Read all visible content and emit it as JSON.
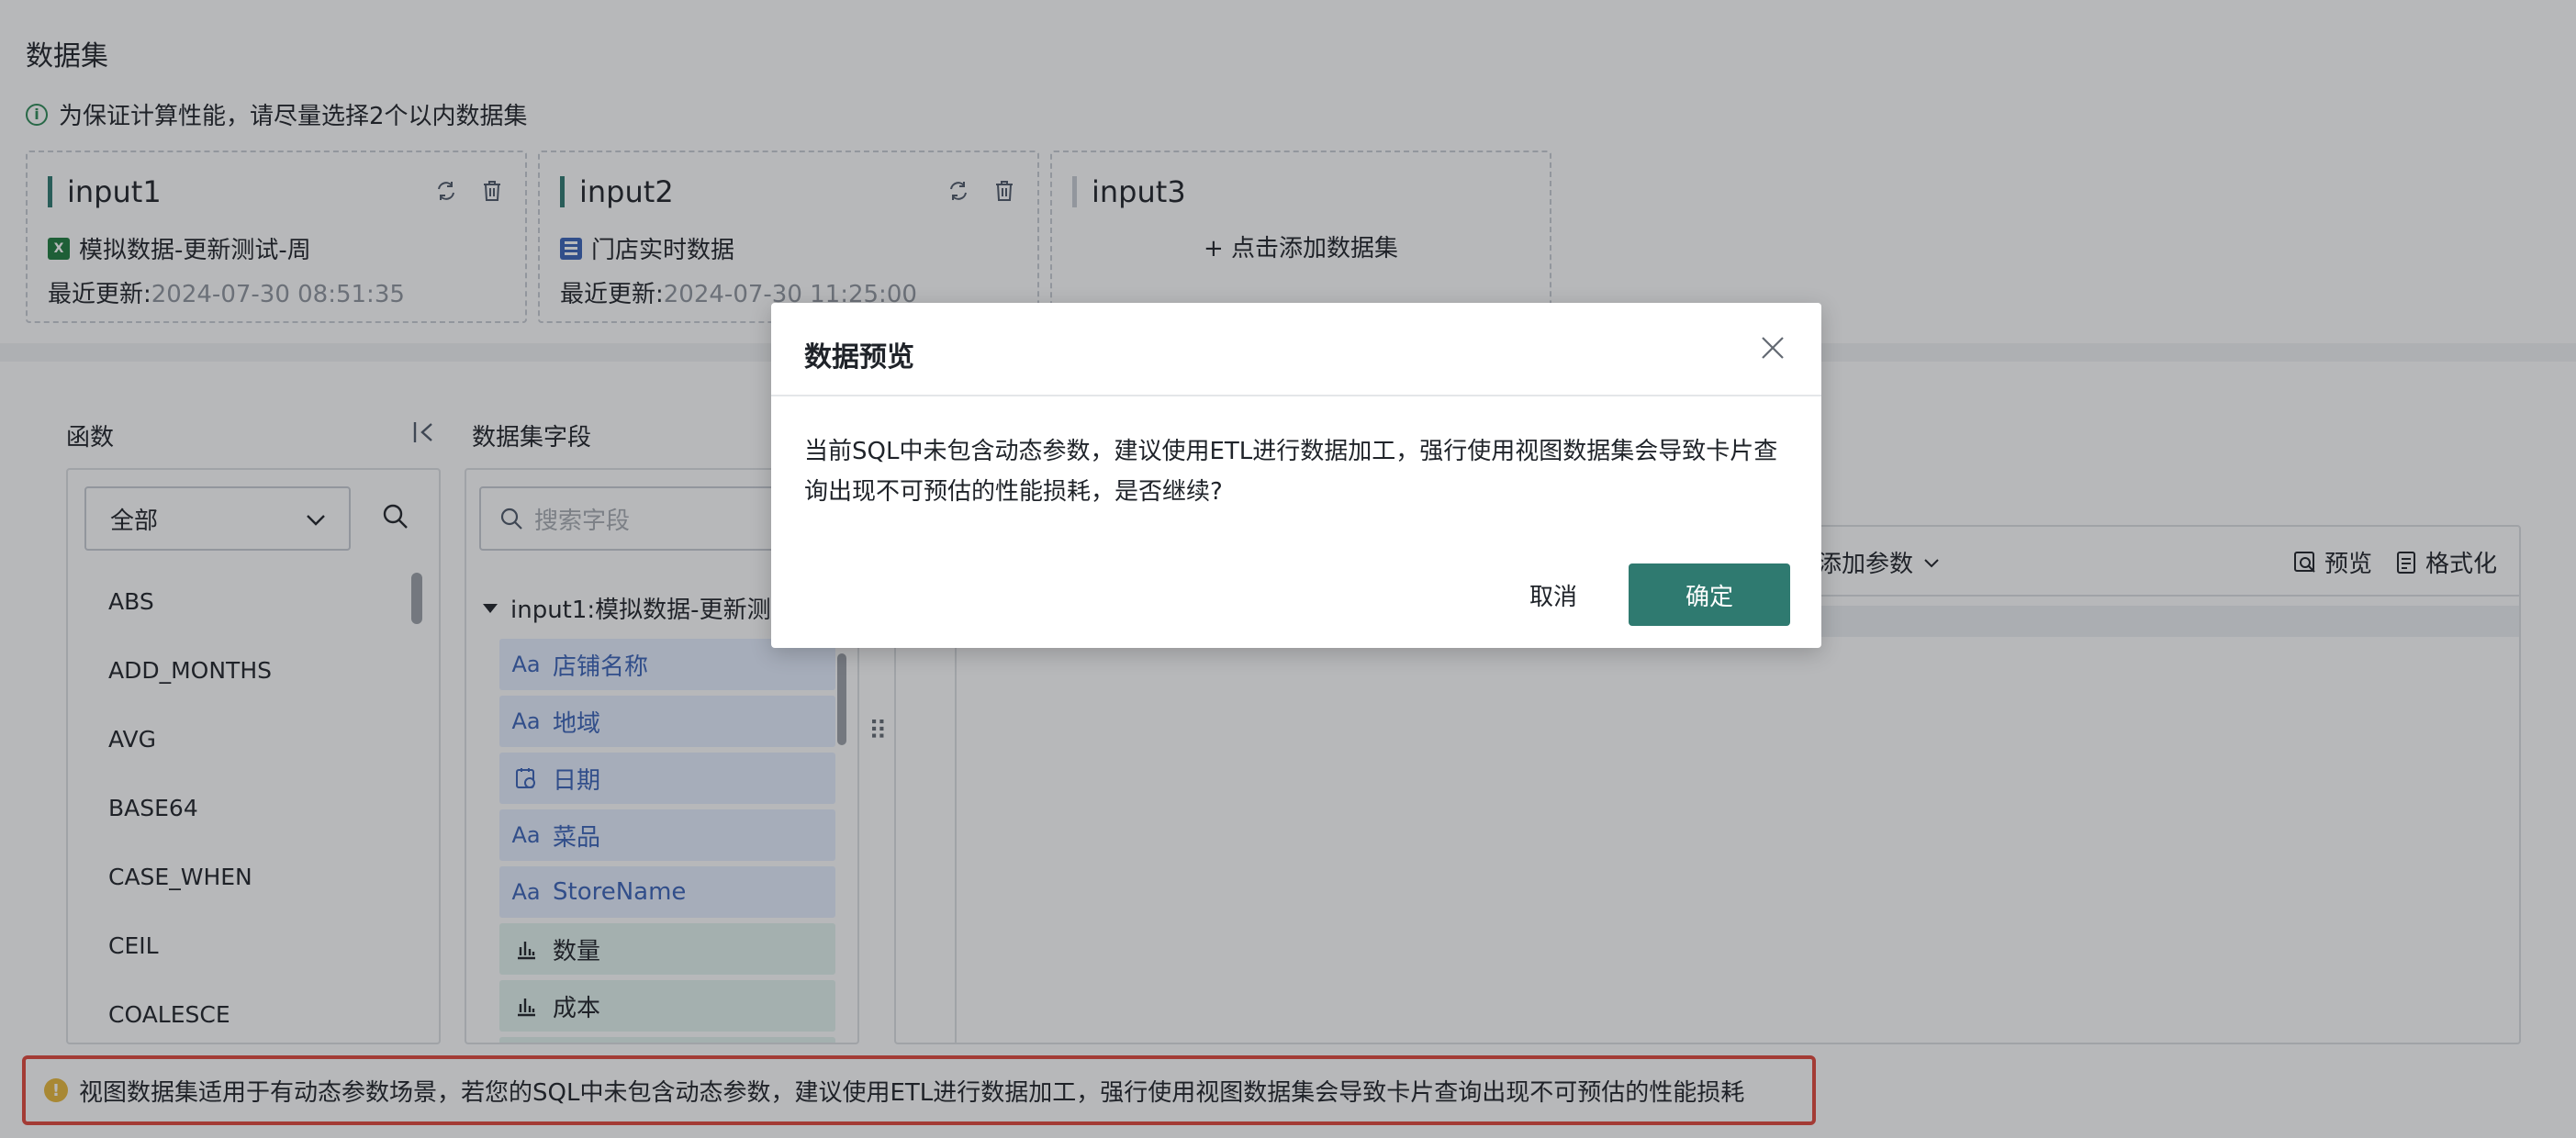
{
  "header": {
    "title": "数据集",
    "tip": "为保证计算性能，请尽量选择2个以内数据集"
  },
  "datasets": [
    {
      "name": "input1",
      "source": "模拟数据-更新测试-周",
      "updated_label": "最近更新:",
      "updated_value": "2024-07-30 08:51:35"
    },
    {
      "name": "input2",
      "source": "门店实时数据",
      "updated_label": "最近更新:",
      "updated_value": "2024-07-30 11:25:00"
    },
    {
      "name": "input3",
      "add_label": "+ 点击添加数据集"
    }
  ],
  "functions": {
    "title": "函数",
    "select_value": "全部",
    "items": [
      "ABS",
      "ADD_MONTHS",
      "AVG",
      "BASE64",
      "CASE_WHEN",
      "CEIL",
      "COALESCE"
    ]
  },
  "fields_panel": {
    "title": "数据集字段",
    "search_placeholder": "搜索字段",
    "group": "input1:模拟数据-更新测",
    "fields": [
      {
        "icon": "Aa",
        "name": "店铺名称"
      },
      {
        "icon": "Aa",
        "name": "地域"
      },
      {
        "icon": "date",
        "name": "日期"
      },
      {
        "icon": "Aa",
        "name": "菜品"
      },
      {
        "icon": "Aa",
        "name": "StoreName"
      },
      {
        "icon": "measure",
        "name": "数量"
      },
      {
        "icon": "measure",
        "name": "成本"
      }
    ]
  },
  "sql_toolbar": {
    "add_param": "添加参数",
    "preview": "预览",
    "format": "格式化"
  },
  "warning_bar": "视图数据集适用于有动态参数场景，若您的SQL中未包含动态参数，建议使用ETL进行数据加工，强行使用视图数据集会导致卡片查询出现不可预估的性能损耗",
  "modal": {
    "title": "数据预览",
    "message": "当前SQL中未包含动态参数，建议使用ETL进行数据加工，强行使用视图数据集会导致卡片查询出现不可预估的性能损耗，是否继续?",
    "cancel": "取消",
    "confirm": "确定"
  },
  "colors": {
    "primary": "#2f7a70",
    "dimension_text": "#3a63b8",
    "warning_border": "#e2473c"
  }
}
